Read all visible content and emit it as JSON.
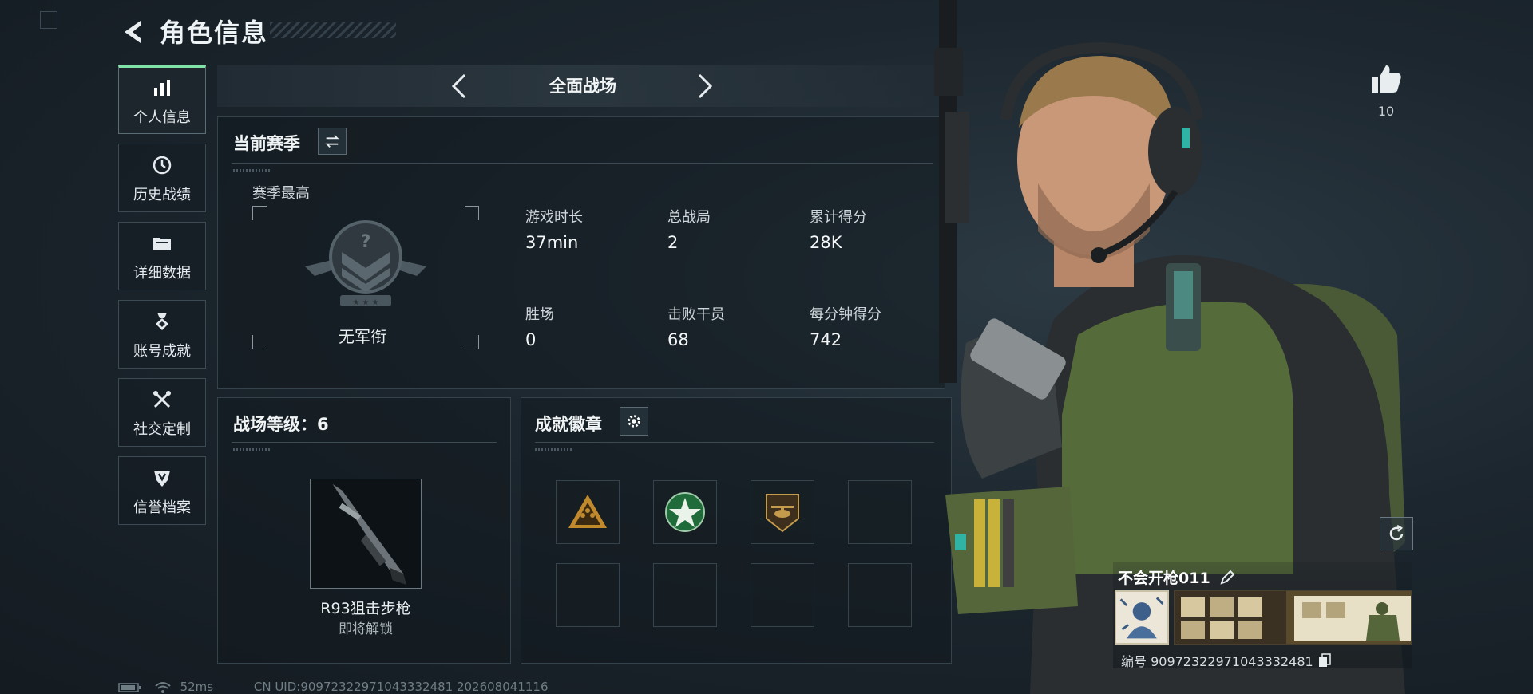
{
  "header": {
    "title": "角色信息",
    "back_icon": "back-arrow-icon"
  },
  "nav": {
    "items": [
      {
        "label": "个人信息",
        "icon": "bar-chart-icon",
        "active": true
      },
      {
        "label": "历史战绩",
        "icon": "clock-icon",
        "active": false
      },
      {
        "label": "详细数据",
        "icon": "folder-icon",
        "active": false
      },
      {
        "label": "账号成就",
        "icon": "medal-icon",
        "active": false
      },
      {
        "label": "社交定制",
        "icon": "tools-icon",
        "active": false
      },
      {
        "label": "信誉档案",
        "icon": "shield-icon",
        "active": false
      }
    ]
  },
  "mode": {
    "label": "全面战场",
    "prev_icon": "chevron-left-icon",
    "next_icon": "chevron-right-icon"
  },
  "season": {
    "title": "当前赛季",
    "swap_icon": "swap-arrows-icon",
    "best_label": "赛季最高",
    "rank_name": "无军衔",
    "stats": [
      {
        "label": "游戏时长",
        "value": "37min"
      },
      {
        "label": "总战局",
        "value": "2"
      },
      {
        "label": "累计得分",
        "value": "28K"
      },
      {
        "label": "胜场",
        "value": "0"
      },
      {
        "label": "击败干员",
        "value": "68"
      },
      {
        "label": "每分钟得分",
        "value": "742"
      }
    ]
  },
  "battlefield": {
    "title": "战场等级：6",
    "weapon_name": "R93狙击步枪",
    "weapon_status": "即将解锁"
  },
  "achievements": {
    "title": "成就徽章",
    "settings_icon": "gear-icon",
    "badges": [
      {
        "icon": "soldiers-emblem-icon",
        "filled": true
      },
      {
        "icon": "green-star-emblem-icon",
        "filled": true
      },
      {
        "icon": "helicopter-emblem-icon",
        "filled": true
      },
      {
        "icon": "",
        "filled": false
      },
      {
        "icon": "",
        "filled": false
      },
      {
        "icon": "",
        "filled": false
      },
      {
        "icon": "",
        "filled": false
      },
      {
        "icon": "",
        "filled": false
      }
    ]
  },
  "status_bar": {
    "ping": "52ms",
    "uid_line": "CN UID:9097232297104333248​1 202608041116"
  },
  "profile": {
    "likes": "10",
    "player_name": "不会开枪011",
    "player_id": "编号 9097232297104333248​1"
  },
  "colors": {
    "accent_green": "#7fe3a8",
    "background": "#1c262e",
    "panel_border": "#34424b"
  }
}
